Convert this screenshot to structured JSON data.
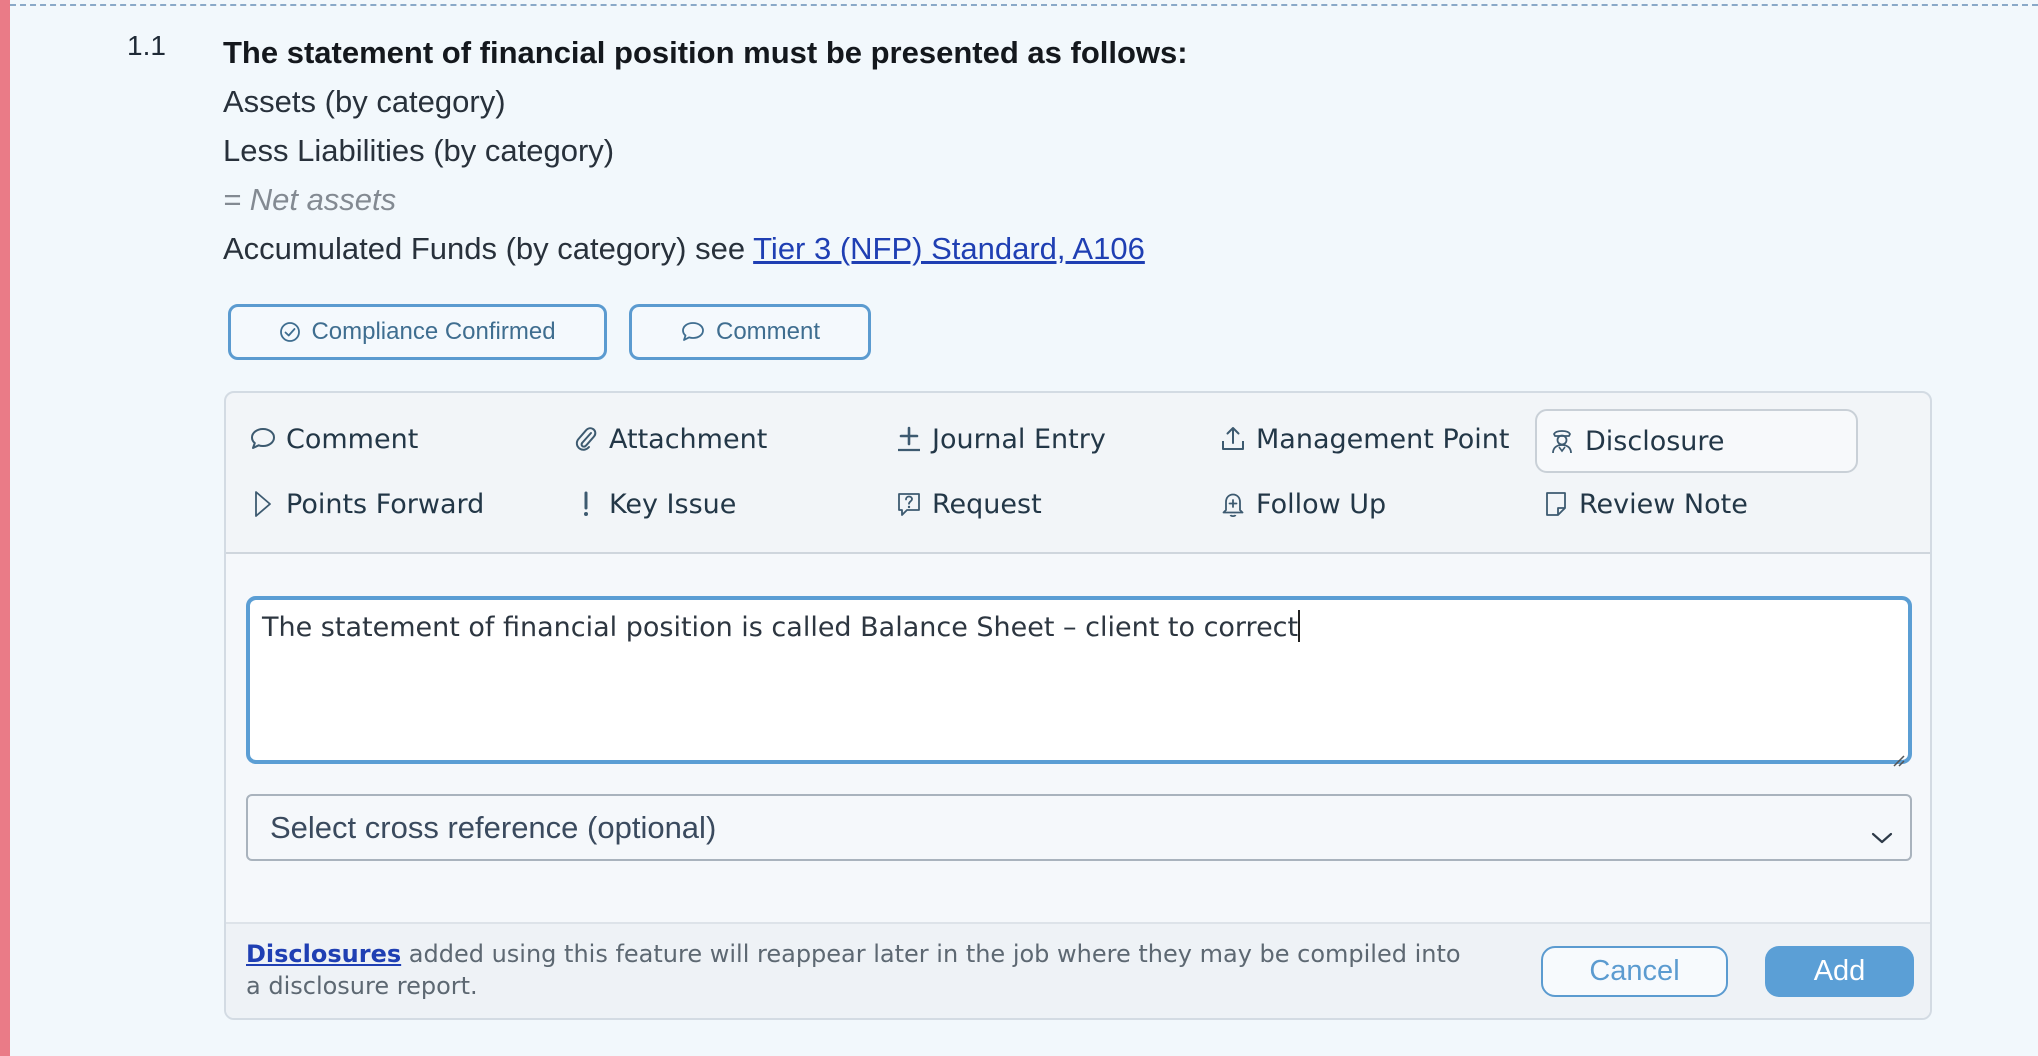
{
  "item": {
    "number": "1.1",
    "title": "The statement of financial position must be presented as follows:",
    "lines": [
      "Assets (by category)",
      "Less Liabilities (by category)",
      "= Net assets"
    ],
    "accumulated_prefix": "Accumulated Funds (by category) see ",
    "reference_link": "Tier 3 (NFP) Standard, A106"
  },
  "actions": {
    "compliance_confirmed": "Compliance Confirmed",
    "comment": "Comment"
  },
  "panel": {
    "note_types": [
      {
        "label": "Comment",
        "icon": "speech-bubble-icon"
      },
      {
        "label": "Attachment",
        "icon": "paperclip-icon"
      },
      {
        "label": "Journal Entry",
        "icon": "plus-underline-icon"
      },
      {
        "label": "Management Point",
        "icon": "upload-tray-icon"
      },
      {
        "label": "Disclosure",
        "icon": "auditor-person-icon",
        "selected": true
      },
      {
        "label": "Points Forward",
        "icon": "play-outline-icon"
      },
      {
        "label": "Key Issue",
        "icon": "exclamation-icon"
      },
      {
        "label": "Request",
        "icon": "question-bubble-icon"
      },
      {
        "label": "Follow Up",
        "icon": "bell-plus-icon"
      },
      {
        "label": "Review Note",
        "icon": "note-page-icon"
      }
    ],
    "note_text": "The statement of financial position is called Balance Sheet – client to correct",
    "cross_reference_placeholder": "Select cross reference (optional)",
    "footer": {
      "link": "Disclosures",
      "text": " added using this feature will reappear later in the job where they may be compiled into a disclosure report."
    },
    "cancel_label": "Cancel",
    "add_label": "Add"
  },
  "colors": {
    "accent": "#5b9fd6",
    "left_bar": "#ea7b87",
    "link": "#1f3fb3",
    "page_bg": "#f2f8fc"
  }
}
